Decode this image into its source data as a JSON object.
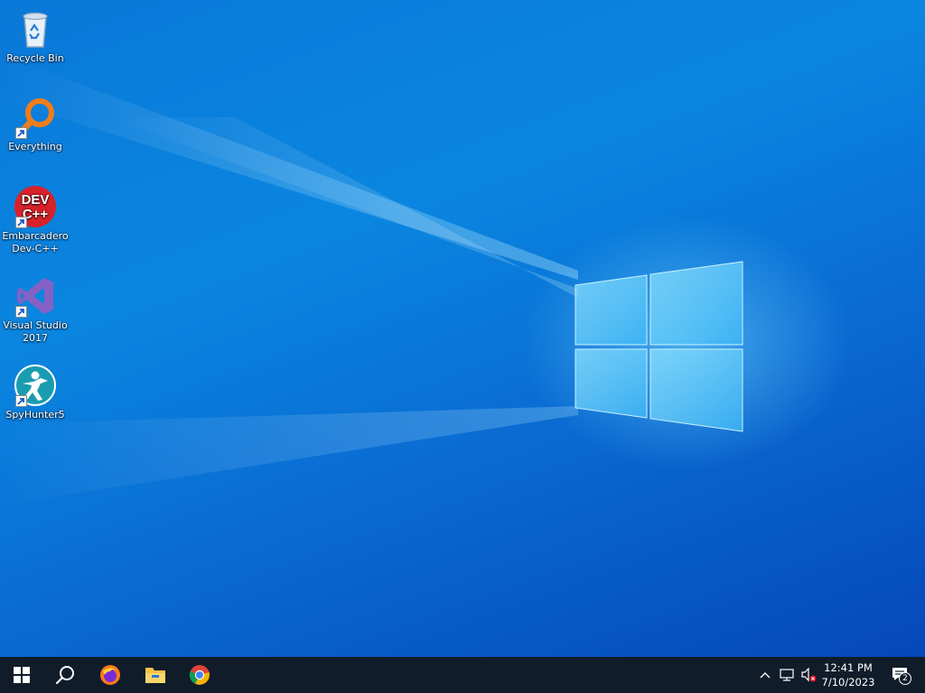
{
  "desktop": {
    "icons": [
      {
        "label": "Recycle Bin",
        "shortcut": false
      },
      {
        "label": "Everything",
        "shortcut": true
      },
      {
        "label": "Embarcadero Dev-C++",
        "shortcut": true
      },
      {
        "label": "Visual Studio 2017",
        "shortcut": true
      },
      {
        "label": "SpyHunter5",
        "shortcut": true
      }
    ],
    "devcpp_logo_text": {
      "line1": "DEV",
      "line2": "C++"
    }
  },
  "taskbar": {
    "pinned": [
      {
        "icon": "start-windows-icon"
      },
      {
        "icon": "search-icon"
      },
      {
        "icon": "firefox-icon"
      },
      {
        "icon": "file-explorer-icon"
      },
      {
        "icon": "chrome-icon"
      }
    ],
    "tray": {
      "show_hidden_icon": "chevron-up-icon",
      "network_icon": "network-icon",
      "volume_icon": "volume-muted-icon",
      "time": "12:41 PM",
      "date": "7/10/2023",
      "notification_count": "2"
    }
  },
  "colors": {
    "wallpaper_blue": "#0a78d8",
    "taskbar_bg": "#101c2a",
    "devcpp_red": "#d8222a",
    "everything_orange": "#f07d1a",
    "vs_purple": "#8661c5",
    "spyhunter_teal": "#1a9cb0"
  }
}
